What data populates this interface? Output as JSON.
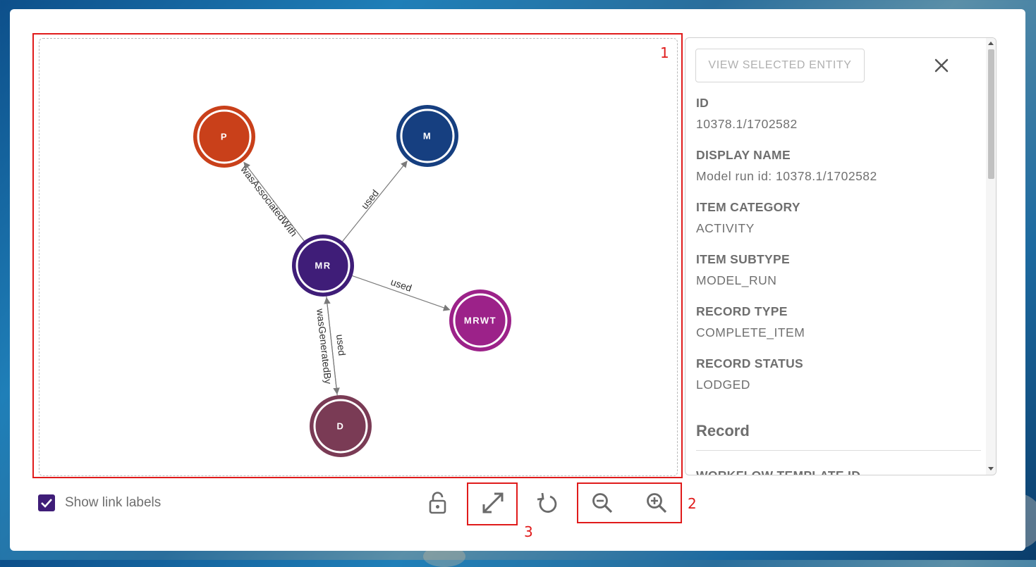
{
  "graph": {
    "nodes": [
      {
        "id": "P",
        "label": "P",
        "color": "#c9401a"
      },
      {
        "id": "M",
        "label": "M",
        "color": "#163f80"
      },
      {
        "id": "MR",
        "label": "MR",
        "color": "#3f1d78"
      },
      {
        "id": "MRWT",
        "label": "MRWT",
        "color": "#9c2289"
      },
      {
        "id": "D",
        "label": "D",
        "color": "#7a3b55"
      }
    ],
    "edges": [
      {
        "from": "MR",
        "to": "P",
        "label": "wasAssociatedWith"
      },
      {
        "from": "MR",
        "to": "M",
        "label": "used"
      },
      {
        "from": "MR",
        "to": "MRWT",
        "label": "used"
      },
      {
        "from": "MR",
        "to": "D",
        "label": "used"
      },
      {
        "from": "D",
        "to": "MR",
        "label": "wasGeneratedBy"
      }
    ]
  },
  "annotations": {
    "graph_area": "1",
    "zoom_controls": "2",
    "fit_control": "3"
  },
  "side_panel": {
    "view_button": "VIEW SELECTED ENTITY",
    "fields": [
      {
        "label": "ID",
        "value": "10378.1/1702582"
      },
      {
        "label": "DISPLAY NAME",
        "value": "Model run id: 10378.1/1702582"
      },
      {
        "label": "ITEM CATEGORY",
        "value": "ACTIVITY"
      },
      {
        "label": "ITEM SUBTYPE",
        "value": "MODEL_RUN"
      },
      {
        "label": "RECORD TYPE",
        "value": "COMPLETE_ITEM"
      },
      {
        "label": "RECORD STATUS",
        "value": "LODGED"
      }
    ],
    "record_heading": "Record",
    "next_field_label": "WORKFLOW TEMPLATE ID"
  },
  "toolbar": {
    "show_link_labels": "Show link labels",
    "show_link_labels_checked": true,
    "icons": [
      "lock-open-icon",
      "fit-expand-icon",
      "reset-rotate-icon",
      "zoom-out-icon",
      "zoom-in-icon"
    ]
  },
  "colors": {
    "accent": "#3f1d78",
    "highlight": "#e01b1b"
  }
}
